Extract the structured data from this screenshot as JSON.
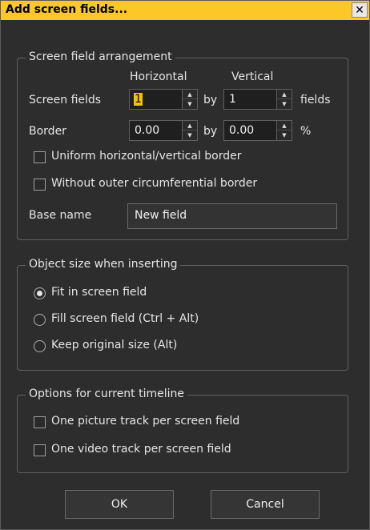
{
  "dialog": {
    "title": "Add screen fields...",
    "close_glyph": "✕"
  },
  "arrangement": {
    "legend": "Screen field arrangement",
    "col_horizontal": "Horizontal",
    "col_vertical": "Vertical",
    "screen_fields_label": "Screen fields",
    "screen_fields_h": "1",
    "screen_fields_v": "1",
    "by_label": "by",
    "fields_unit": "fields",
    "border_label": "Border",
    "border_h": "0.00",
    "border_v": "0.00",
    "percent_unit": "%",
    "uniform_label": "Uniform horizontal/vertical border",
    "uniform_checked": false,
    "without_outer_label": "Without outer circumferential border",
    "without_outer_checked": false,
    "base_name_label": "Base name",
    "base_name_value": "New field"
  },
  "object_size": {
    "legend": "Object size when inserting",
    "options": [
      "Fit in screen field",
      "Fill screen field (Ctrl + Alt)",
      "Keep original size (Alt)"
    ],
    "selected": "Fit in screen field"
  },
  "timeline": {
    "legend": "Options for current timeline",
    "picture_track_label": "One picture track per screen field",
    "picture_track_checked": false,
    "video_track_label": "One video track per screen field",
    "video_track_checked": false
  },
  "buttons": {
    "ok": "OK",
    "cancel": "Cancel"
  },
  "spin_up_glyph": "▲",
  "spin_down_glyph": "▼",
  "colors": {
    "titlebar": "#fcc828",
    "background": "#2d2d2d",
    "selection": "#f2c300"
  }
}
